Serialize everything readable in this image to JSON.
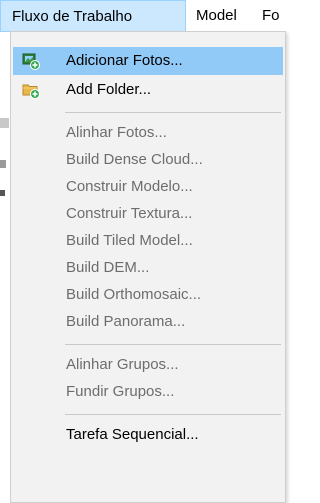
{
  "menubar": {
    "items": [
      {
        "label": "Fluxo de Trabalho",
        "active": true
      },
      {
        "label": "Model"
      },
      {
        "label": "Fo"
      }
    ]
  },
  "menu": {
    "items": [
      {
        "label": "Adicionar Fotos...",
        "enabled": true,
        "icon": "add-photos-icon",
        "highlighted": true
      },
      {
        "label": "Add Folder...",
        "enabled": true,
        "icon": "add-folder-icon"
      },
      {
        "label": "Alinhar Fotos...",
        "enabled": false
      },
      {
        "label": "Build Dense Cloud...",
        "enabled": false
      },
      {
        "label": "Construir Modelo...",
        "enabled": false
      },
      {
        "label": "Construir Textura...",
        "enabled": false
      },
      {
        "label": "Build Tiled Model...",
        "enabled": false
      },
      {
        "label": "Build DEM...",
        "enabled": false
      },
      {
        "label": "Build Orthomosaic...",
        "enabled": false
      },
      {
        "label": "Build Panorama...",
        "enabled": false
      },
      {
        "label": "Alinhar Grupos...",
        "enabled": false
      },
      {
        "label": "Fundir Grupos...",
        "enabled": false
      },
      {
        "label": "Tarefa Sequencial...",
        "enabled": true
      }
    ]
  },
  "colors": {
    "highlight": "#91c9f7",
    "menubar_active": "#cce8ff",
    "menu_background": "#f2f2f2",
    "disabled_text": "#6d6d6d"
  }
}
